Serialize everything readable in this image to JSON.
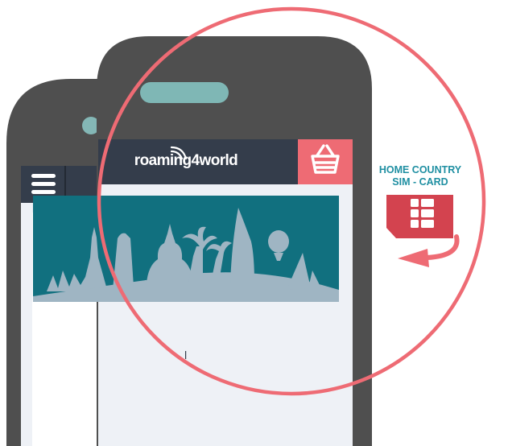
{
  "app": {
    "brand_name": "roaming4world"
  },
  "sim_card": {
    "label_line1": "HOME COUNTRY",
    "label_line2": "SIM - CARD"
  },
  "icons": {
    "menu": "hamburger-menu-icon",
    "cart": "shopping-basket-icon",
    "wifi": "wifi-signal-icon",
    "sim": "sim-card-icon",
    "arrow": "curved-arrow-icon"
  },
  "colors": {
    "phone_body": "#4f4f4f",
    "header_bar": "#343d4b",
    "accent_red": "#ee6b74",
    "banner_teal": "#11707f",
    "skyline": "#9fb5c3",
    "sim_red": "#d3434f",
    "label_teal": "#1f8fa2",
    "speaker": "#7fb7b5"
  }
}
